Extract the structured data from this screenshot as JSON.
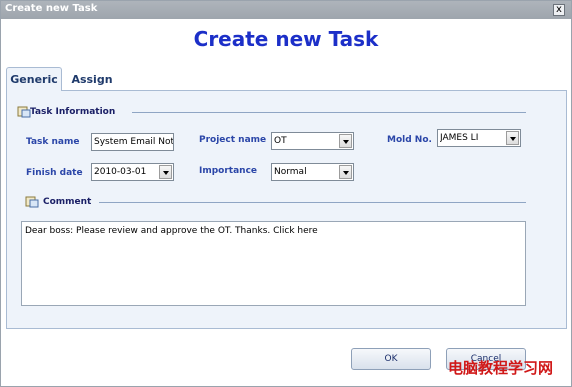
{
  "window": {
    "title": "Create new Task",
    "close_glyph": "x"
  },
  "header": {
    "title": "Create new Task"
  },
  "tabs": [
    {
      "label": "Generic"
    },
    {
      "label": "Assign"
    }
  ],
  "task_section": {
    "title": "Task Information"
  },
  "fields": {
    "task_name": {
      "label": "Task name",
      "value": "System Email Not"
    },
    "project_name": {
      "label": "Project name",
      "value": "OT"
    },
    "mold_no": {
      "label": "Mold No.",
      "value": "JAMES LI"
    },
    "finish_date": {
      "label": "Finish date",
      "value": "2010-03-01"
    },
    "importance": {
      "label": "Importance",
      "value": "Normal"
    }
  },
  "comment_section": {
    "title": "Comment"
  },
  "comment": {
    "value": "Dear boss: Please review and approve the OT. Thanks. Click here"
  },
  "buttons": {
    "ok": "OK",
    "cancel": "Cancel"
  },
  "watermark": "电脑教程学习网",
  "colors": {
    "title_blue": "#1c2fc8",
    "label_blue": "#2b46a8",
    "panel_bg": "#eef3fa",
    "watermark_red": "#d01818"
  }
}
